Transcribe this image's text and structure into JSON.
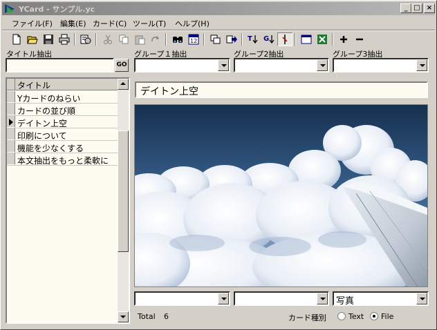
{
  "window": {
    "title": "YCard - サンプル.yc",
    "minimize": "_",
    "maximize": "□",
    "close": "×"
  },
  "menu": [
    "ファイル(F)",
    "編集(E)",
    "カード(C)",
    "ツール(T)",
    "ヘルプ(H)"
  ],
  "toolbar": [
    "new-icon",
    "open-icon",
    "save-icon",
    "print-icon",
    "settings-icon",
    "cut-icon",
    "copy-icon",
    "paste-icon",
    "redo-icon",
    "find-icon",
    "calendar-icon",
    "window-icon",
    "forward-icon",
    "sort-title-icon",
    "sort-group-icon",
    "filter-icon",
    "form-icon",
    "excel-icon",
    "add-icon",
    "remove-icon"
  ],
  "filters": {
    "title_label": "タイトル抽出",
    "title_value": "",
    "go_label": "GO",
    "group1_label": "グループ１抽出",
    "group2_label": "グループ2抽出",
    "group3_label": "グループ3抽出"
  },
  "list": {
    "header": "タイトル",
    "items": [
      "Yカードのねらい",
      "カードの並び順",
      "デイトン上空",
      "印刷について",
      "機能を少なくする",
      "本文抽出をもっと柔軟に"
    ],
    "selected_index": 2
  },
  "card": {
    "title": "デイトン上空",
    "group1": "",
    "group2": "",
    "group3": "写真"
  },
  "status": {
    "total_label": "Total",
    "total_value": "6",
    "kind_label": "カード種別",
    "text_option": "Text",
    "file_option": "File",
    "selected_kind": "File"
  }
}
